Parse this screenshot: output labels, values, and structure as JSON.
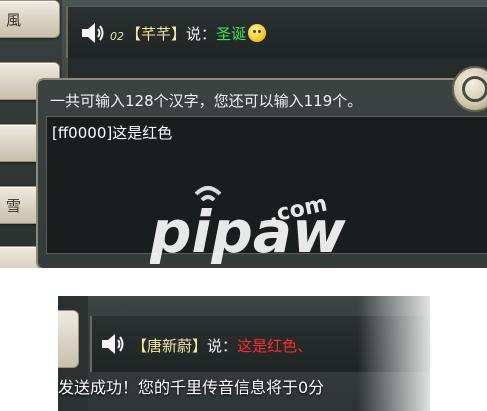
{
  "side_tabs": [
    "風",
    "",
    "",
    "雪",
    ""
  ],
  "top_chat": {
    "level": "02",
    "open_bracket": "【",
    "sender": "芊芊",
    "close_bracket": "】",
    "said": "说：",
    "message": "圣诞"
  },
  "input_panel": {
    "hint": "一共可输入128个汉字，您还可以输入119个。",
    "value": "[ff0000]这是红色"
  },
  "watermark": {
    "main": "pipaw",
    "sub": ".com"
  },
  "bottom_chat": {
    "open_bracket": "【",
    "sender": "唐新蔚",
    "close_bracket": "】",
    "said": "说：",
    "message": "这是红色、"
  },
  "status_message": "发送成功！您的千里传音信息将于0分",
  "colors": {
    "green_text": "#3fe05a",
    "red_text": "#ff2a2a",
    "gold_name": "#f3e6a0"
  }
}
